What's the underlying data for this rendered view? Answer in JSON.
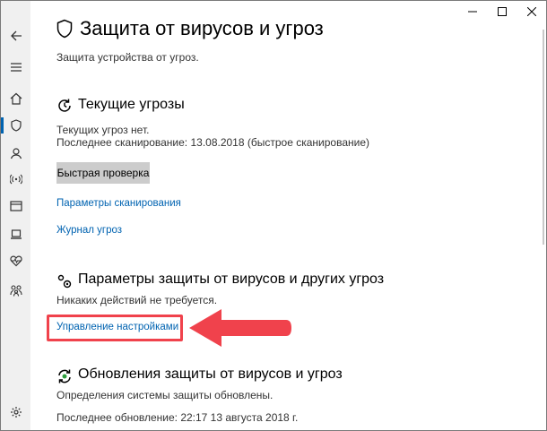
{
  "window": {
    "title": "Защита от вирусов и угроз",
    "subtitle": "Защита устройства от угроз."
  },
  "sidebar": {
    "items": [
      {
        "icon": "back-arrow-icon"
      },
      {
        "icon": "hamburger-menu-icon"
      },
      {
        "icon": "home-icon"
      },
      {
        "icon": "shield-icon",
        "active": true
      },
      {
        "icon": "person-icon"
      },
      {
        "icon": "wireless-icon"
      },
      {
        "icon": "app-browser-icon"
      },
      {
        "icon": "laptop-icon"
      },
      {
        "icon": "heart-icon"
      },
      {
        "icon": "family-icon"
      },
      {
        "icon": "gear-icon"
      }
    ]
  },
  "current_threats": {
    "title": "Текущие угрозы",
    "no_threats": "Текущих угроз нет.",
    "last_scan": "Последнее сканирование: 13.08.2018 (быстрое сканирование)",
    "quick_scan_label": "Быстрая проверка",
    "scan_options_link": "Параметры сканирования",
    "threat_history_link": "Журнал угроз"
  },
  "protection_settings": {
    "title": "Параметры защиты от вирусов и других угроз",
    "status": "Никаких действий не требуется.",
    "manage_link": "Управление настройками"
  },
  "updates": {
    "title": "Обновления защиты от вирусов и угроз",
    "status": "Определения системы защиты обновлены.",
    "last_update": "Последнее обновление: 22:17 13 августа 2018 г."
  },
  "colors": {
    "accent": "#0063b1",
    "highlight": "#f0424c",
    "button_bg": "#cccccc",
    "rail_bg": "#f0f0f0"
  }
}
